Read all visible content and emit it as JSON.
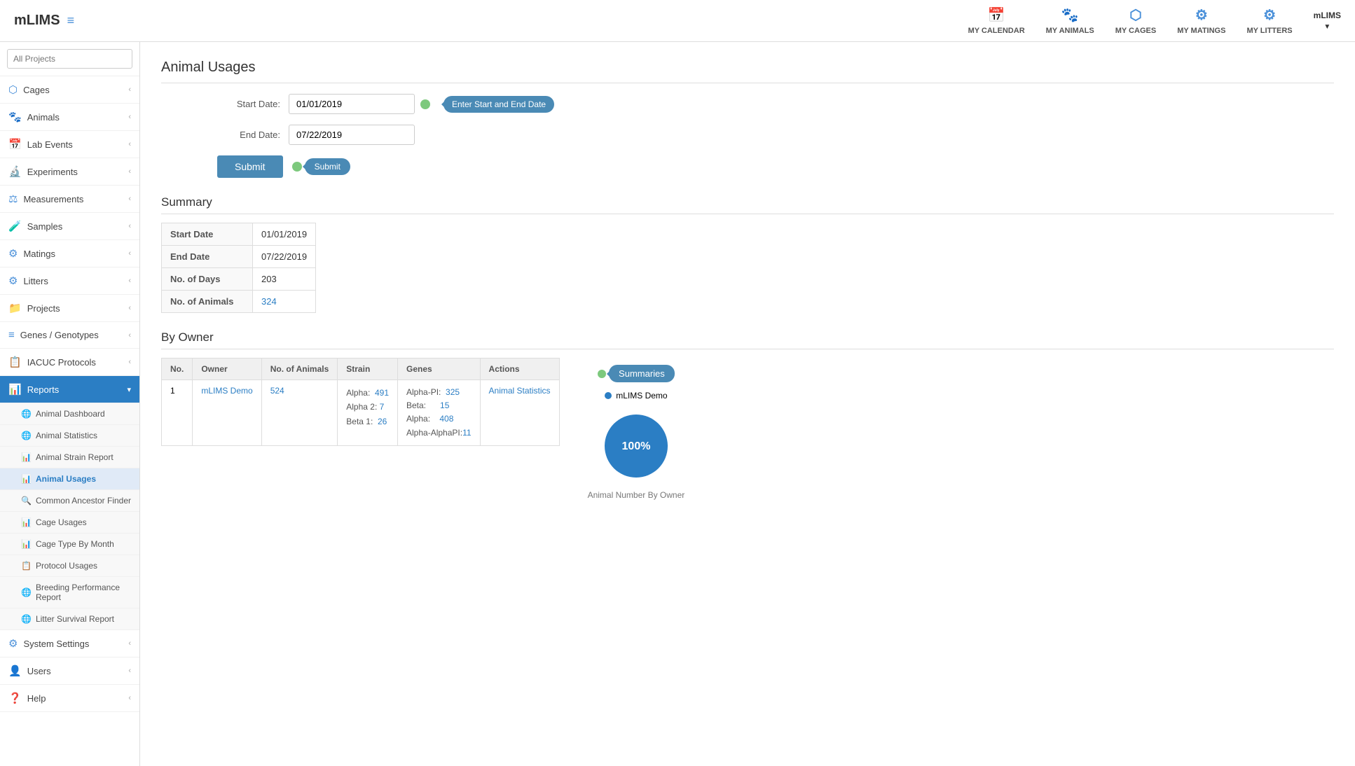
{
  "brand": {
    "name": "mLIMS",
    "hamburger_icon": "≡"
  },
  "top_nav": {
    "items": [
      {
        "id": "my-calendar",
        "label": "MY CALENDAR",
        "icon": "📅"
      },
      {
        "id": "my-animals",
        "label": "MY ANIMALS",
        "icon": "🐾"
      },
      {
        "id": "my-cages",
        "label": "MY CAGES",
        "icon": "🔲"
      },
      {
        "id": "my-matings",
        "label": "MY MATINGS",
        "icon": "⚙"
      },
      {
        "id": "my-litters",
        "label": "MY LITTERS",
        "icon": "⚙"
      }
    ],
    "user": "mLIMS"
  },
  "sidebar": {
    "search_placeholder": "All Projects",
    "items": [
      {
        "id": "cages",
        "label": "Cages",
        "icon": "🔲",
        "has_arrow": true
      },
      {
        "id": "animals",
        "label": "Animals",
        "icon": "🐾",
        "has_arrow": true
      },
      {
        "id": "lab-events",
        "label": "Lab Events",
        "icon": "📅",
        "has_arrow": true
      },
      {
        "id": "experiments",
        "label": "Experiments",
        "icon": "🔬",
        "has_arrow": true
      },
      {
        "id": "measurements",
        "label": "Measurements",
        "icon": "⚖",
        "has_arrow": true
      },
      {
        "id": "samples",
        "label": "Samples",
        "icon": "🧪",
        "has_arrow": true
      },
      {
        "id": "matings",
        "label": "Matings",
        "icon": "⚙",
        "has_arrow": true
      },
      {
        "id": "litters",
        "label": "Litters",
        "icon": "⚙",
        "has_arrow": true
      },
      {
        "id": "projects",
        "label": "Projects",
        "icon": "📁",
        "has_arrow": true
      },
      {
        "id": "genes",
        "label": "Genes / Genotypes",
        "icon": "≡",
        "has_arrow": true
      },
      {
        "id": "iacuc",
        "label": "IACUC Protocols",
        "icon": "📋",
        "has_arrow": true
      },
      {
        "id": "reports",
        "label": "Reports",
        "icon": "📊",
        "has_arrow": true,
        "active": true
      }
    ],
    "sub_items": [
      {
        "id": "animal-dashboard",
        "label": "Animal Dashboard",
        "icon": "🌐"
      },
      {
        "id": "animal-statistics",
        "label": "Animal Statistics",
        "icon": "🌐"
      },
      {
        "id": "animal-strain-report",
        "label": "Animal Strain Report",
        "icon": "📊"
      },
      {
        "id": "animal-usages",
        "label": "Animal Usages",
        "icon": "📊",
        "active": true
      },
      {
        "id": "common-ancestor",
        "label": "Common Ancestor Finder",
        "icon": "🔍"
      },
      {
        "id": "cage-usages",
        "label": "Cage Usages",
        "icon": "📊"
      },
      {
        "id": "cage-type-by-month",
        "label": "Cage Type By Month",
        "icon": "📊"
      },
      {
        "id": "protocol-usages",
        "label": "Protocol Usages",
        "icon": "📋"
      },
      {
        "id": "breeding-performance",
        "label": "Breeding Performance Report",
        "icon": "🌐"
      },
      {
        "id": "litter-survival",
        "label": "Litter Survival Report",
        "icon": "🌐"
      }
    ],
    "bottom_items": [
      {
        "id": "system-settings",
        "label": "System Settings",
        "icon": "⚙",
        "has_arrow": true
      },
      {
        "id": "users",
        "label": "Users",
        "icon": "👤",
        "has_arrow": true
      },
      {
        "id": "help",
        "label": "Help",
        "icon": "❓",
        "has_arrow": true
      }
    ]
  },
  "page": {
    "title": "Animal Usages",
    "form": {
      "start_date_label": "Start Date:",
      "start_date_value": "01/01/2019",
      "end_date_label": "End Date:",
      "end_date_value": "07/22/2019",
      "tooltip_text": "Enter Start and End Date",
      "submit_label": "Submit",
      "submit_tooltip": "Submit"
    },
    "summary": {
      "title": "Summary",
      "rows": [
        {
          "label": "Start Date",
          "value": "01/01/2019",
          "is_link": false
        },
        {
          "label": "End Date",
          "value": "07/22/2019",
          "is_link": false
        },
        {
          "label": "No. of Days",
          "value": "203",
          "is_link": false
        },
        {
          "label": "No. of Animals",
          "value": "324",
          "is_link": true
        }
      ]
    },
    "by_owner": {
      "title": "By Owner",
      "table": {
        "headers": [
          "No.",
          "Owner",
          "No. of Animals",
          "Strain",
          "Genes",
          "Actions"
        ],
        "rows": [
          {
            "no": "1",
            "owner": "mLIMS Demo",
            "num_animals": "524",
            "strain": "Alpha: 491\nAlpha 2: 7\nBeta 1: 26",
            "genes_lines": [
              {
                "label": "Alpha-PI:",
                "value": "325"
              },
              {
                "label": "Beta:",
                "value": "15"
              },
              {
                "label": "Alpha:",
                "value": "408"
              },
              {
                "label": "Alpha-AlphaPI:",
                "value": "11"
              }
            ],
            "action": "Animal Statistics"
          }
        ]
      },
      "summaries_tooltip": "Summaries",
      "chart": {
        "legend_label": "mLIMS Demo",
        "percent": "100%",
        "label": "Animal Number By Owner",
        "color": "#2b7ec4"
      }
    }
  }
}
